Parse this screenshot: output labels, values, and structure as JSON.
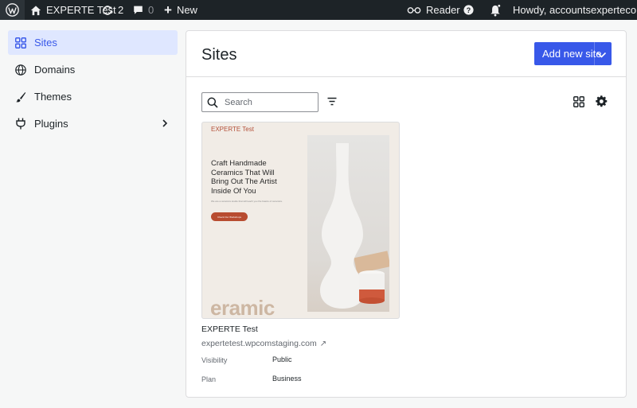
{
  "adminbar": {
    "site_name": "EXPERTE Test",
    "updates_count": "2",
    "comments_count": "0",
    "new_label": "New",
    "reader_label": "Reader",
    "howdy_label": "Howdy, accountsexpertecom"
  },
  "sidebar": {
    "items": [
      {
        "label": "Sites",
        "icon": "sites-grid-icon"
      },
      {
        "label": "Domains",
        "icon": "globe-icon"
      },
      {
        "label": "Themes",
        "icon": "brush-icon"
      },
      {
        "label": "Plugins",
        "icon": "plug-icon"
      }
    ]
  },
  "main": {
    "title": "Sites",
    "add_new_label": "Add new site",
    "search_placeholder": "Search",
    "site": {
      "name": "EXPERTE Test",
      "url": "expertetest.wpcomstaging.com",
      "visibility_label": "Visibility",
      "visibility_value": "Public",
      "plan_label": "Plan",
      "plan_value": "Business",
      "preview": {
        "brand": "EXPERTE Test",
        "headline": "Craft Handmade Ceramics That Will Bring Out The Artist Inside Of You",
        "sub": "We are a ceramics studio that will teach you the basics of ceramics.",
        "cta": "Check Our Workshops",
        "big_text": "eramic"
      }
    }
  },
  "colors": {
    "accent": "#3858e9",
    "adminbar_bg": "#1d2327",
    "active_bg": "#dfe7ff",
    "terracotta": "#b84c30"
  }
}
